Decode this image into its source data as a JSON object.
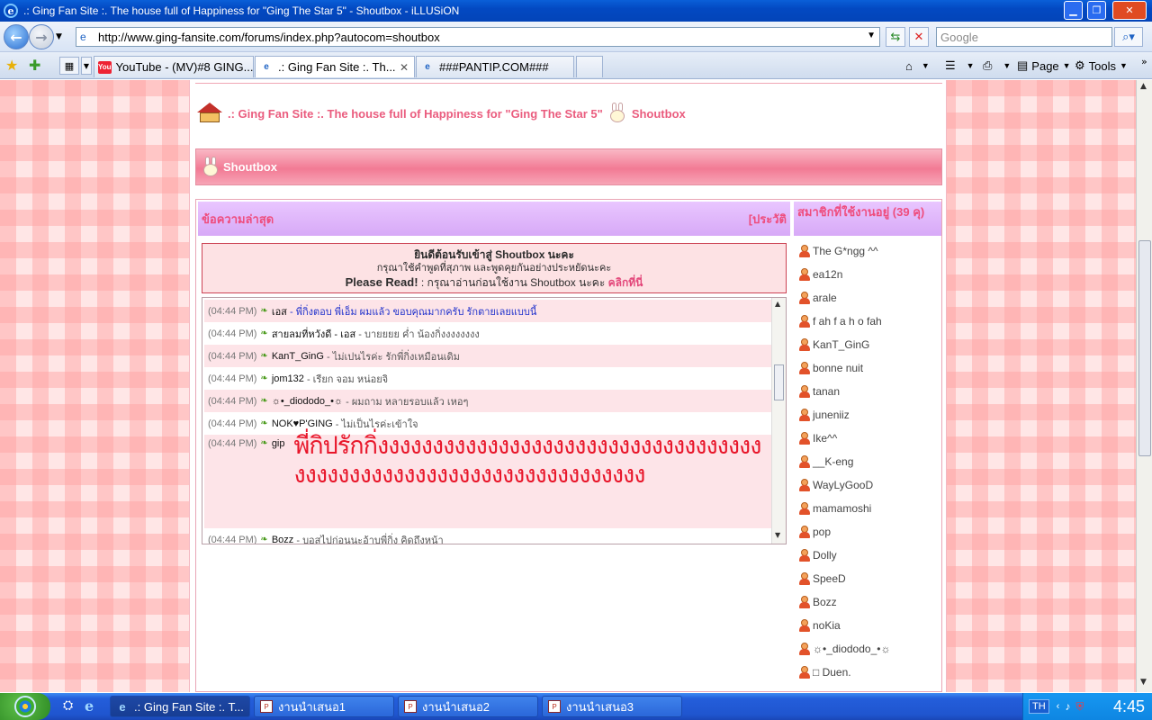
{
  "window": {
    "title": ".: Ging Fan Site :. The house full of Happiness for \"Ging The Star 5\" - Shoutbox - iLLUSiON"
  },
  "navbar": {
    "url": "http://www.ging-fansite.com/forums/index.php?autocom=shoutbox",
    "search_placeholder": "Google"
  },
  "tabs": [
    {
      "label": "YouTube - (MV)#8 GING..."
    },
    {
      "label": ".: Ging Fan Site :. Th..."
    },
    {
      "label": "###PANTIP.COM###"
    }
  ],
  "toolbar": {
    "page_label": "Page",
    "tools_label": "Tools"
  },
  "page": {
    "breadcrumb_site": ".: Ging Fan Site :. The house full of Happiness for \"Ging The Star 5\"",
    "breadcrumb_section": "Shoutbox",
    "header_title": "Shoutbox",
    "left_head": "ข้อความล่าสุด",
    "history_link": "[ประวัติ",
    "right_head": "สมาชิกที่ใช้งานอยู่ (39 คุ)",
    "welcome": {
      "line1": "ยินดีต้อนรับเข้าสู่ Shoutbox นะคะ",
      "line2": "กรุณาใช้คำพูดที่สุภาพ และพูดคุยกันอย่างประหยัดนะคะ",
      "line3_bold": "Please Read!",
      "line3_text": ": กรุณาอ่านก่อนใช้งาน Shoutbox นะคะ",
      "line3_link": "คลิกที่นี่"
    }
  },
  "messages": [
    {
      "time": "(04:44 PM)",
      "name": "เอส",
      "text": "- พี่กิ่งตอบ พี่เอ็ม ผมแล้ว ขอบคุณมากครับ รักตายเลยแบบนี้"
    },
    {
      "time": "(04:44 PM)",
      "name": "สายลมที่หวังดี - เอส",
      "text": "- บายยยย ค่ำ น้องกิ่งงงงงงงง"
    },
    {
      "time": "(04:44 PM)",
      "name": "KanT_GinG",
      "text": "- ไม่เปนไรค่ะ รักพี่กิ่งเหมือนเดิม"
    },
    {
      "time": "(04:44 PM)",
      "name": "jom132",
      "text": "- เรียก จอม หน่อยจิ"
    },
    {
      "time": "(04:44 PM)",
      "name": "☼•_diododo_•☼",
      "text": "- ผมถาม หลายรอบแล้ว เหอๆ"
    },
    {
      "time": "(04:44 PM)",
      "name": "NOK♥P'GING",
      "text": "- ไม่เป็นไรค่ะเข้าใจ"
    },
    {
      "time": "(04:44 PM)",
      "name": "gip",
      "text": "พี่กิปรักกิ่งงงงงงงงงงงงงงงงงงงงงงงงงงงงงงงงงงงงงงงงงงงงงงงงงงงงงงงงงงงงงงงงงงง"
    },
    {
      "time": "(04:44 PM)",
      "name": "Bozz",
      "text": "- บอสไปก่อนนะอ้าบพี่กิ่ง คิดถึงหน้า"
    }
  ],
  "members": [
    "The G*ngg ^^",
    "ea12n",
    "arale",
    "f ah f a h o fah",
    "KanT_GinG",
    "bonne nuit",
    "tanan",
    "juneniiz",
    "Ike^^",
    "__K-eng",
    "WayLyGooD",
    "mamamoshi",
    "pop",
    "Dolly",
    "SpeeD",
    "Bozz",
    "noKia",
    "☼•_diododo_•☼",
    "□ Duen."
  ],
  "taskbar": {
    "items": [
      {
        "label": ".: Ging Fan Site :. T..."
      },
      {
        "label": "งานนำเสนอ1"
      },
      {
        "label": "งานนำเสนอ2"
      },
      {
        "label": "งานนำเสนอ3"
      }
    ],
    "lang": "TH",
    "clock": "4:45"
  }
}
